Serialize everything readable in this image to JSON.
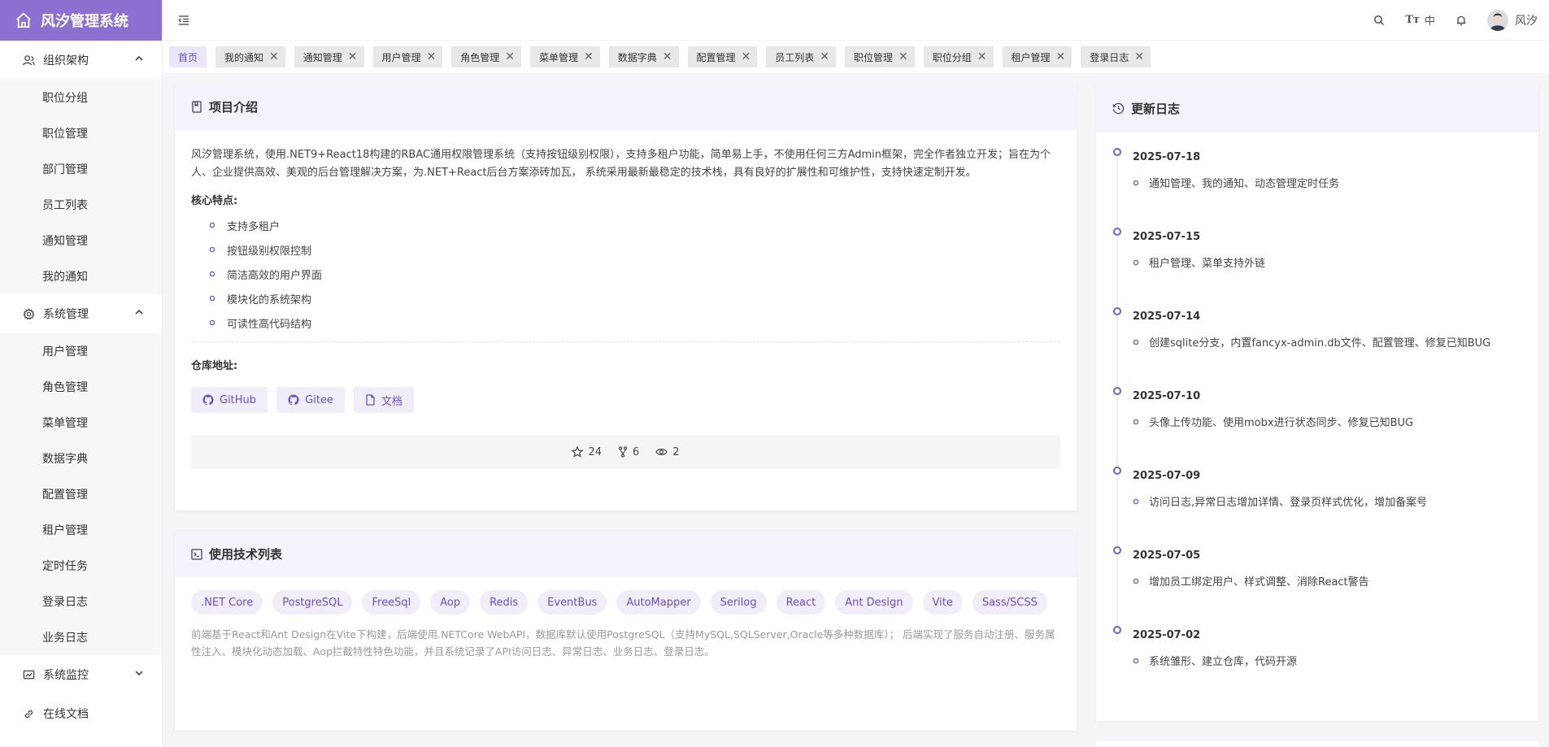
{
  "app": {
    "title": "风汐管理系统"
  },
  "sidebar": {
    "groups": [
      {
        "label": "组织架构",
        "icon": "org-icon",
        "expanded": true,
        "items": [
          "职位分组",
          "职位管理",
          "部门管理",
          "员工列表",
          "通知管理",
          "我的通知"
        ]
      },
      {
        "label": "系统管理",
        "icon": "gear-icon",
        "expanded": true,
        "items": [
          "用户管理",
          "角色管理",
          "菜单管理",
          "数据字典",
          "配置管理",
          "租户管理",
          "定时任务",
          "登录日志",
          "业务日志"
        ]
      },
      {
        "label": "系统监控",
        "icon": "monitor-icon",
        "expanded": false,
        "items": []
      },
      {
        "label": "在线文档",
        "icon": "link-icon",
        "expanded": false,
        "items": []
      }
    ]
  },
  "header": {
    "lang_icon": "Tт",
    "lang": "中",
    "username": "风汐"
  },
  "tabs": [
    {
      "label": "首页",
      "active": true
    },
    {
      "label": "我的通知"
    },
    {
      "label": "通知管理"
    },
    {
      "label": "用户管理"
    },
    {
      "label": "角色管理"
    },
    {
      "label": "菜单管理"
    },
    {
      "label": "数据字典"
    },
    {
      "label": "配置管理"
    },
    {
      "label": "员工列表"
    },
    {
      "label": "职位管理"
    },
    {
      "label": "职位分组"
    },
    {
      "label": "租户管理"
    },
    {
      "label": "登录日志"
    }
  ],
  "intro": {
    "title": "项目介绍",
    "description": "风汐管理系统，使用.NET9+React18构建的RBAC通用权限管理系统（支持按钮级别权限），支持多租户功能，简单易上手，不使用任何三方Admin框架，完全作者独立开发；旨在为个人、企业提供高效、美观的后台管理解决方案，为.NET+React后台方案添砖加瓦， 系统采用最新最稳定的技术栈，具有良好的扩展性和可维护性，支持快速定制开发。",
    "features_label": "核心特点:",
    "features": [
      "支持多租户",
      "按钮级别权限控制",
      "简洁高效的用户界面",
      "模块化的系统架构",
      "可读性高代码结构"
    ],
    "repo_label": "仓库地址:",
    "repos": [
      {
        "label": "GitHub",
        "icon": "github-icon"
      },
      {
        "label": "Gitee",
        "icon": "github-icon"
      },
      {
        "label": "文档",
        "icon": "document-icon"
      }
    ],
    "stats": {
      "stars": "24",
      "forks": "6",
      "watchers": "2"
    }
  },
  "tech": {
    "title": "使用技术列表",
    "chips": [
      ".NET Core",
      "PostgreSQL",
      "FreeSql",
      "Aop",
      "Redis",
      "EventBus",
      "AutoMapper",
      "Serilog",
      "React",
      "Ant Design",
      "Vite",
      "Sass/SCSS"
    ],
    "note": "前端基于React和Ant Design在Vite下构建，后端使用.NETCore WebAPI，数据库默认使用PostgreSQL（支持MySQL,SQLServer,Oracle等多种数据库）； 后端实现了服务自动注册、服务属性注入、模块化动态加载、Aop拦截特性特色功能，并且系统记录了API访问日志、异常日志、业务日志、登录日志。"
  },
  "changelog": {
    "title": "更新日志",
    "entries": [
      {
        "date": "2025-07-18",
        "text": "通知管理、我的通知、动态管理定时任务"
      },
      {
        "date": "2025-07-15",
        "text": "租户管理、菜单支持外链"
      },
      {
        "date": "2025-07-14",
        "text": "创建sqlite分支，内置fancyx-admin.db文件、配置管理、修复已知BUG"
      },
      {
        "date": "2025-07-10",
        "text": "头像上传功能、使用mobx进行状态同步、修复已知BUG"
      },
      {
        "date": "2025-07-09",
        "text": "访问日志,异常日志增加详情、登录页样式优化，增加备案号"
      },
      {
        "date": "2025-07-05",
        "text": "增加员工绑定用户、样式调整、消除React警告"
      },
      {
        "date": "2025-07-02",
        "text": "系统雏形、建立仓库，代码开源"
      }
    ]
  },
  "colors": {
    "brand": "#8b6fd1",
    "accent": "#6b4fc7",
    "chip_bg": "#f1eefa"
  }
}
